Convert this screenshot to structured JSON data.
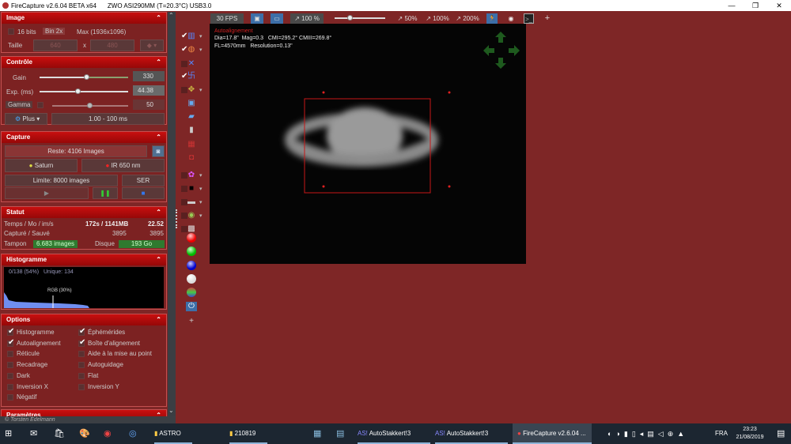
{
  "window": {
    "app_title": "FireCapture v2.6.04 BETA x64",
    "camera": "ZWO ASI290MM (T=20.3°C) USB3.0",
    "minimize": "—",
    "maximize": "❐",
    "close": "✕"
  },
  "image_section": {
    "title": "Image",
    "bits": "16 bits",
    "bin": "Bin 2x",
    "max": "Max (1936x1096)",
    "size_label": "Taille",
    "width": "640",
    "x": "x",
    "height": "480"
  },
  "controle": {
    "title": "Contrôle",
    "gain_label": "Gain",
    "gain_value": "330",
    "gain_fraction": 0.55,
    "exp_label": "Exp. (ms)",
    "exp_value": "44.38",
    "exp_fraction": 0.44,
    "gamma_label": "Gamma",
    "gamma_value": "50",
    "gamma_fraction": 0.5,
    "plus_label": "Plus",
    "range": "1.00 - 100 ms"
  },
  "capture": {
    "title": "Capture",
    "remaining": "Reste: 4106 Images",
    "object": "Saturn",
    "filter": "IR 650 nm",
    "limit": "Limite: 8000 images",
    "format": "SER"
  },
  "statut": {
    "title": "Statut",
    "time_label": "Temps / Mo / im/s",
    "time_value": "172s / 1141MB",
    "fps_value": "22.52",
    "captured_label": "Capturé / Sauvé",
    "captured": "3895",
    "saved": "3895",
    "buffer_label": "Tampon",
    "buffer_value": "6.683 images",
    "disk_label": "Disque",
    "disk_value": "193 Go"
  },
  "histogramme": {
    "title": "Histogramme",
    "info": "0/138 (54%)",
    "unique": "Unique: 134",
    "marker": "RGB (30%)"
  },
  "options": {
    "title": "Options",
    "items": [
      {
        "label": "Histogramme",
        "checked": true
      },
      {
        "label": "Éphémérides",
        "checked": true
      },
      {
        "label": "Autoalignement",
        "checked": true
      },
      {
        "label": "Boîte d'alignement",
        "checked": true
      },
      {
        "label": "Réticule",
        "checked": false
      },
      {
        "label": "Aide à la mise au point",
        "checked": false
      },
      {
        "label": "Recadrage",
        "checked": false
      },
      {
        "label": "Autoguidage",
        "checked": false
      },
      {
        "label": "Dark",
        "checked": false
      },
      {
        "label": "Flat",
        "checked": false
      },
      {
        "label": "Inversion X",
        "checked": false
      },
      {
        "label": "Inversion Y",
        "checked": false
      },
      {
        "label": "Négatif",
        "checked": false
      }
    ]
  },
  "parametres": {
    "title": "Paramètres"
  },
  "footer": "© Torsten Edelmann",
  "toolbar": {
    "fps": "30 FPS",
    "zoom": "100 %",
    "zoom50": "50%",
    "zoom100": "100%",
    "zoom200": "200%",
    "add": "+"
  },
  "overlay": {
    "mode": "Autoalignement",
    "line1": "Dia=17.8\"  Mag=0.3   CMI=295.2° CMIII=269.8°",
    "line2": "FL=4570mm   Resolution=0.13\""
  },
  "taskbar": {
    "astro": "ASTRO",
    "folder": "210819",
    "as1": "AutoStakkert!3",
    "as2": "AutoStakkert!3",
    "fc": "FireCapture v2.6.04 ...",
    "lang": "FRA",
    "time": "23:23",
    "date": "21/08/2019"
  },
  "colors": {
    "background": "#7e2626",
    "header": "#c80f0f",
    "alignment_box": "#d01818",
    "green": "#2f7a2f"
  }
}
